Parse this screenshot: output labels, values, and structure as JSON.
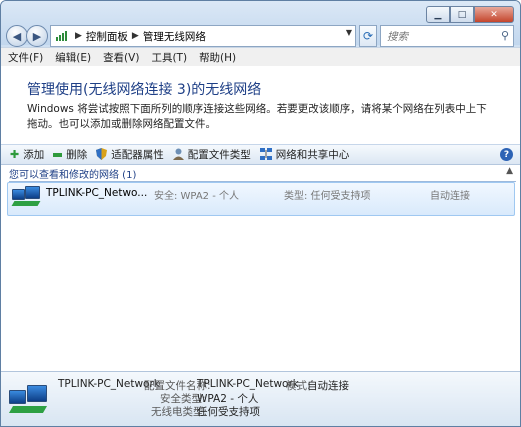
{
  "window": {
    "caption": {
      "minimize": "▁",
      "maximize": "□",
      "close": "✕"
    }
  },
  "address": {
    "crumbs": [
      "控制面板",
      "管理无线网络"
    ]
  },
  "search": {
    "placeholder": "搜索"
  },
  "menu": [
    "文件(F)",
    "编辑(E)",
    "查看(V)",
    "工具(T)",
    "帮助(H)"
  ],
  "header": {
    "title": "管理使用(无线网络连接 3)的无线网络",
    "description": "Windows 将尝试按照下面所列的顺序连接这些网络。若要更改该顺序，请将某个网络在列表中上下拖动。也可以添加或删除网络配置文件。"
  },
  "toolbar": {
    "add": "添加",
    "remove": "删除",
    "adapter": "适配器属性",
    "profile_types": "配置文件类型",
    "network_center": "网络和共享中心"
  },
  "group": {
    "title": "您可以查看和修改的网络 (1)"
  },
  "networks": [
    {
      "name": "TPLINK-PC_Netwo...",
      "security": "安全: WPA2 - 个人",
      "type": "类型: 任何受支持项",
      "mode": "自动连接"
    }
  ],
  "details": {
    "name": "TPLINK-PC_Network",
    "profile_label": "配置文件名称:",
    "profile_value": "TPLINK-PC_Network",
    "mode_label": "模式:",
    "mode_value": "自动连接",
    "security_label": "安全类型:",
    "security_value": "WPA2 - 个人",
    "radio_label": "无线电类型:",
    "radio_value": "任何受支持项"
  },
  "colors": {
    "title_blue": "#1e3f86",
    "selection": "#d9eafc",
    "chrome": "#cfe0f2"
  }
}
